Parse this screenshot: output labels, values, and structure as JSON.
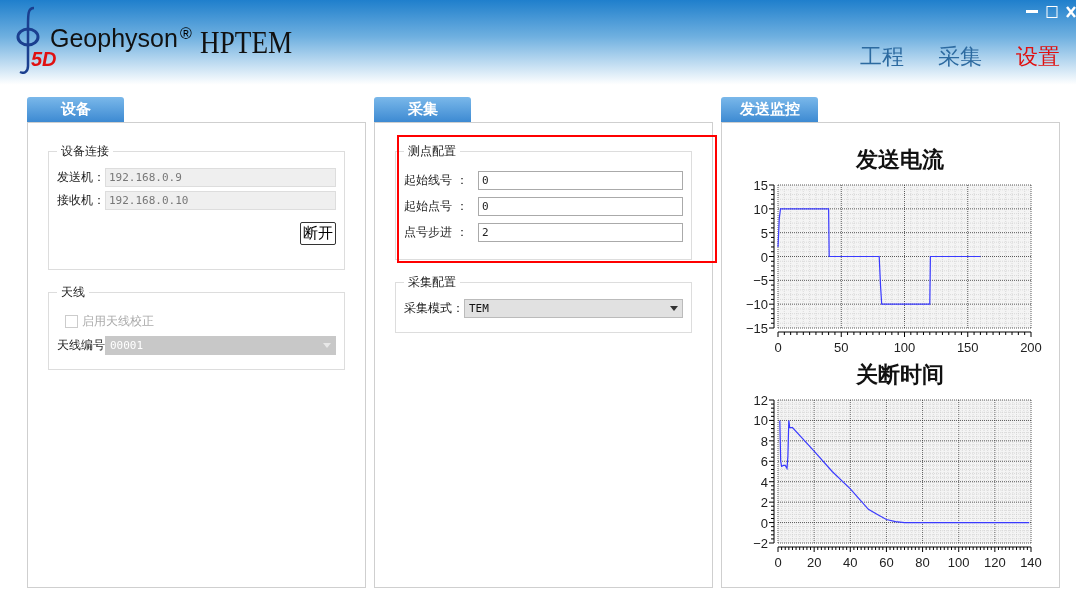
{
  "window": {
    "logo_mark": "5D",
    "brand": "Geophyson",
    "brand_sup": "®",
    "product": "HPTEM"
  },
  "nav": [
    {
      "label": "工程",
      "selected": false
    },
    {
      "label": "采集",
      "selected": false
    },
    {
      "label": "设置",
      "selected": true
    }
  ],
  "device_panel": {
    "tab": "设备",
    "connection": {
      "legend": "设备连接",
      "fields": [
        {
          "label": "发送机：",
          "value": "192.168.0.9",
          "disabled": true
        },
        {
          "label": "接收机：",
          "value": "192.168.0.10",
          "disabled": true
        }
      ],
      "button": "断开"
    },
    "antenna": {
      "legend": "天线",
      "checkbox": {
        "label": "启用天线校正",
        "checked": false,
        "disabled": true
      },
      "select": {
        "label": "天线编号",
        "value": "00001",
        "disabled": true
      }
    }
  },
  "acquisition_panel": {
    "tab": "采集",
    "highlighted": true,
    "point_config": {
      "legend": "测点配置",
      "fields": [
        {
          "label": "起始线号 ：",
          "value": "0"
        },
        {
          "label": "起始点号 ：",
          "value": "0"
        },
        {
          "label": "点号步进 ：",
          "value": "2"
        }
      ]
    },
    "acq_config": {
      "legend": "采集配置",
      "select": {
        "label": "采集模式：",
        "value": "TEM"
      }
    }
  },
  "monitor_panel": {
    "tab": "发送监控",
    "charts": [
      {
        "chart_data": {
          "type": "line",
          "title": "发送电流",
          "x": [
            0,
            1,
            2,
            3,
            40,
            40.5,
            80,
            81,
            82,
            83,
            120,
            120.5,
            160
          ],
          "series": [
            {
              "color": "#3a3aff",
              "values": [
                2,
                8,
                10,
                10,
                10,
                0,
                0,
                -6,
                -10,
                -10,
                -10,
                0,
                0
              ]
            }
          ],
          "grid": true,
          "xlim": [
            0,
            200
          ],
          "ylim": [
            -15,
            15
          ],
          "xticks": [
            0,
            50,
            100,
            150,
            200
          ],
          "yticks": [
            -15,
            -10,
            -5,
            0,
            5,
            10,
            15
          ]
        }
      },
      {
        "chart_data": {
          "type": "line",
          "title": "关断时间",
          "x": [
            1,
            1.5,
            2,
            3,
            4,
            5,
            5.5,
            6,
            6.5,
            8,
            20,
            30,
            40,
            50,
            55,
            60,
            65,
            70,
            80,
            100,
            120,
            139
          ],
          "series": [
            {
              "color": "#3a3aff",
              "values": [
                10,
                6,
                5.5,
                5.6,
                5.6,
                5.3,
                6.5,
                10,
                9.3,
                9.3,
                7,
                5,
                3.3,
                1.3,
                0.8,
                0.3,
                0.1,
                0,
                0,
                0,
                0,
                0
              ]
            }
          ],
          "grid": true,
          "xlim": [
            0,
            140
          ],
          "ylim": [
            -2,
            12
          ],
          "xticks": [
            0,
            20,
            40,
            60,
            80,
            100,
            120,
            140
          ],
          "yticks": [
            -2,
            0,
            2,
            4,
            6,
            8,
            10,
            12
          ]
        }
      }
    ]
  }
}
